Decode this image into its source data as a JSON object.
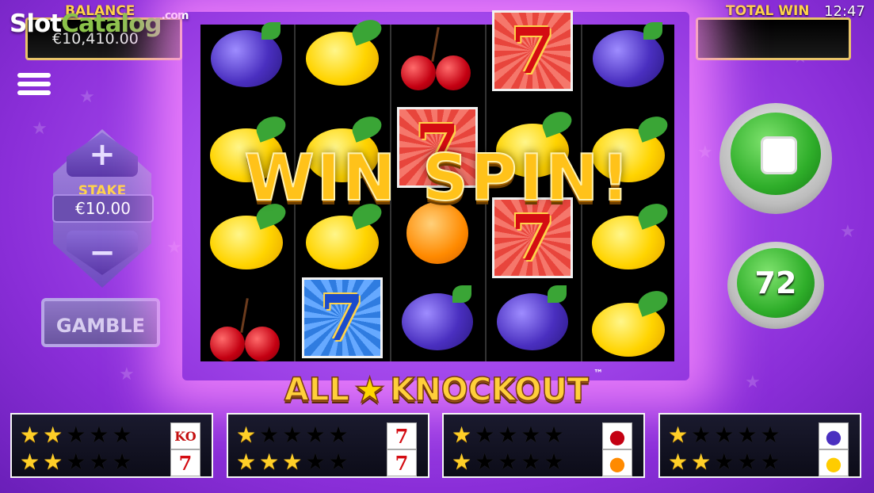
{
  "watermark": {
    "text_a": "Slot",
    "text_b": "Catalog",
    "text_c": ".com"
  },
  "balance": {
    "label": "BALANCE",
    "value": "€10,410.00"
  },
  "total_win": {
    "label": "TOTAL WIN",
    "value": ""
  },
  "clock": "12:47",
  "stake": {
    "label": "STAKE",
    "value": "€10.00",
    "plus": "+",
    "minus": "−"
  },
  "gamble": {
    "label": "GAMBLE"
  },
  "banner": "WIN SPIN!",
  "logo": {
    "left": "ALL",
    "right": "KNOCKOUT",
    "tm": "™"
  },
  "autospin": {
    "count": "72"
  },
  "reels": [
    [
      "plum",
      "lemon",
      "lemon",
      "cherry"
    ],
    [
      "lemon",
      "lemon",
      "lemon",
      "seven-blue"
    ],
    [
      "cherry",
      "seven-red",
      "orange",
      "plum"
    ],
    [
      "seven-red",
      "lemon",
      "seven-red",
      "plum"
    ],
    [
      "plum",
      "lemon",
      "lemon",
      "lemon"
    ]
  ],
  "features": [
    {
      "row1_on": 2,
      "row2_on": 2,
      "sym1": "KO",
      "sym2": "7"
    },
    {
      "row1_on": 1,
      "row2_on": 3,
      "sym1": "7",
      "sym2": "7"
    },
    {
      "row1_on": 1,
      "row2_on": 1,
      "sym1": "cherry",
      "sym2": "orange"
    },
    {
      "row1_on": 1,
      "row2_on": 2,
      "sym1": "plum",
      "sym2": "lemon"
    }
  ],
  "colors": {
    "background": "#9a3ee2",
    "accent_gold": "#ffcf28",
    "button_green": "#2fae2a"
  },
  "icons": {
    "menu": "hamburger-icon",
    "stop": "stop-icon",
    "star": "star-icon"
  }
}
